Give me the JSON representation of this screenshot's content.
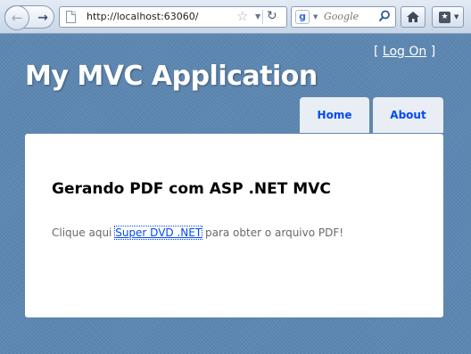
{
  "browser": {
    "url": "http://localhost:63060/",
    "search_placeholder": "Google"
  },
  "header": {
    "login_prefix": "[ ",
    "login_link": "Log On",
    "login_suffix": " ]",
    "title": "My MVC Application"
  },
  "menu": {
    "items": [
      {
        "label": "Home"
      },
      {
        "label": "About"
      }
    ]
  },
  "main": {
    "heading": "Gerando PDF com ASP .NET MVC",
    "text_before": "Clique aqui ",
    "link_text": "Super DVD .NET",
    "text_after": " para obter o arquivo PDF!"
  },
  "colors": {
    "page_background": "#5c87b2",
    "link": "#034af3",
    "body_text": "#696969"
  },
  "icons": [
    "back-arrow-icon",
    "forward-arrow-icon",
    "page-icon",
    "star-icon",
    "reload-icon",
    "google-icon",
    "search-icon",
    "home-icon",
    "bookmarks-icon"
  ]
}
